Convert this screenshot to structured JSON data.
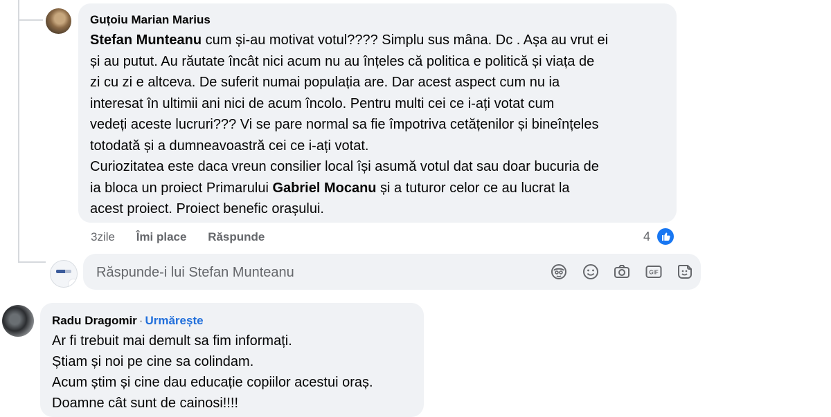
{
  "comment1": {
    "author": "Guțoiu Marian Marius",
    "lines": [
      {
        "mention": "Stefan Munteanu",
        "text": " cum și-au motivat votul???? Simplu sus mâna. Dc . Așa au vrut ei"
      },
      {
        "text": "și au putut. Au răutate încât nici acum nu au înțeles că politica e politică și viața de"
      },
      {
        "text": "zi cu zi e altceva. De suferit numai populația are. Dar acest aspect cum nu ia"
      },
      {
        "text": "interesat în ultimii ani nici de acum încolo. Pentru multi cei ce i-ați votat cum"
      },
      {
        "text": "vedeți aceste lucruri??? Vi se pare normal sa fie împotriva cetățenilor și bineînțeles"
      },
      {
        "text": "totodată și a dumneavoastră cei ce i-ați votat."
      },
      {
        "text": "Curiozitatea este daca vreun consilier local își asumă votul dat sau doar bucuria de"
      },
      {
        "text_before": "ia bloca un proiect Primarului ",
        "mention": "Gabriel Mocanu",
        "text": " și a tuturor celor ce au lucrat la"
      },
      {
        "text": "acest proiect. Proiect benefic orașului."
      }
    ],
    "time": "3zile",
    "like_label": "Îmi place",
    "reply_label": "Răspunde",
    "reaction_count": "4",
    "reaction_icon": "like-reaction-icon"
  },
  "reply_box": {
    "placeholder": "Răspunde-i lui Stefan Munteanu",
    "icons": [
      "avatar-sticker-icon",
      "emoji-icon",
      "camera-icon",
      "gif-icon",
      "sticker-icon"
    ]
  },
  "comment2": {
    "author": "Radu Dragomir",
    "separator": "·",
    "follow_label": "Urmărește",
    "lines": [
      "Ar fi trebuit mai demult sa fim informați.",
      "Știam și noi pe cine sa colindam.",
      "Acum știm și cine dau educație copiilor acestui oraș.",
      "Doamne cât sunt de cainosi!!!!"
    ]
  },
  "colors": {
    "bubble_bg": "#f0f2f5",
    "link_blue": "#216fdb",
    "like_blue": "#1877f2",
    "muted_text": "#65676b"
  }
}
